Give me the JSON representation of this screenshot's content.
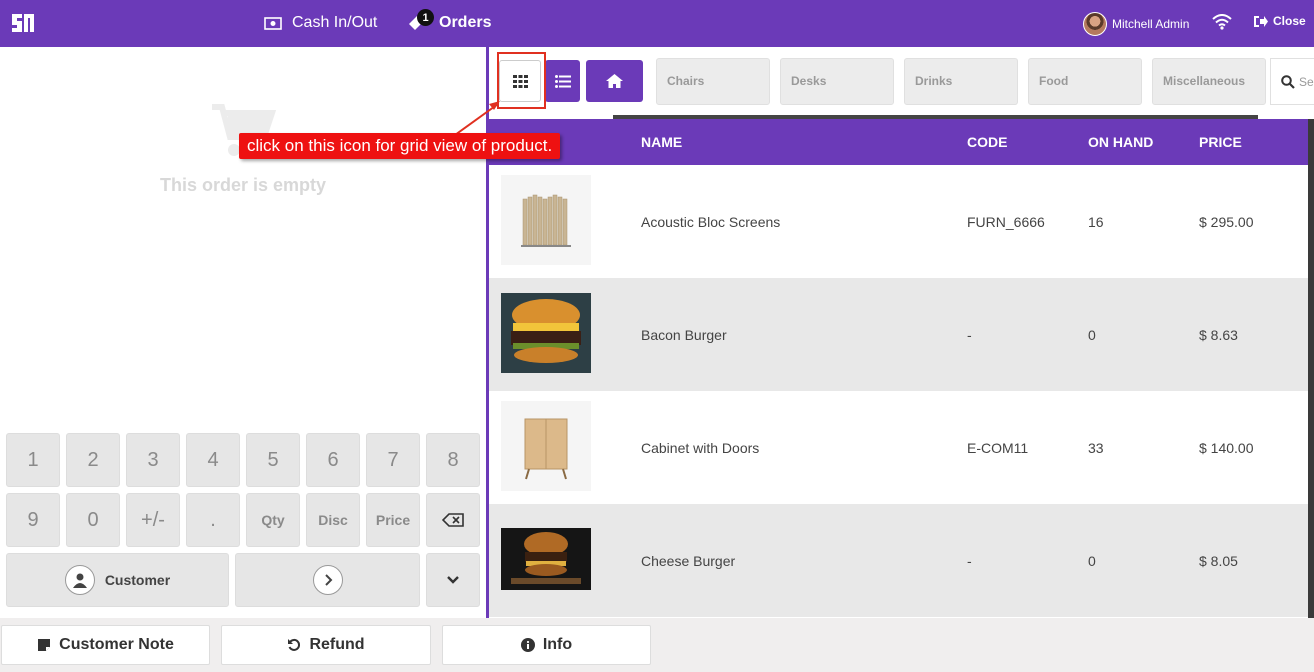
{
  "topbar": {
    "cash_label": "Cash In/Out",
    "orders_label": "Orders",
    "orders_badge": "1",
    "user_name": "Mitchell Admin",
    "close_label": "Close",
    "accent": "#6b3ab8"
  },
  "order": {
    "empty_text": "This order is empty"
  },
  "numpad": {
    "row1": [
      "1",
      "2",
      "3",
      "4",
      "5",
      "6",
      "7",
      "8"
    ],
    "row2": [
      "9",
      "0",
      "+/-",
      ".",
      "Qty",
      "Disc",
      "Price"
    ],
    "customer_label": "Customer"
  },
  "bottom": {
    "customer_note": "Customer Note",
    "refund": "Refund",
    "info": "Info"
  },
  "categories": [
    "Chairs",
    "Desks",
    "Drinks",
    "Food",
    "Miscellaneous"
  ],
  "search": {
    "placeholder": "Se"
  },
  "table": {
    "headers": {
      "name": "NAME",
      "code": "CODE",
      "on_hand": "ON HAND",
      "price": "PRICE"
    },
    "rows": [
      {
        "name": "Acoustic Bloc Screens",
        "code": "FURN_6666",
        "on_hand": "16",
        "price": "$ 295.00",
        "image": "acoustic-screen"
      },
      {
        "name": "Bacon Burger",
        "code": "-",
        "on_hand": "0",
        "price": "$ 8.63",
        "image": "burger"
      },
      {
        "name": "Cabinet with Doors",
        "code": "E-COM11",
        "on_hand": "33",
        "price": "$ 140.00",
        "image": "cabinet"
      },
      {
        "name": "Cheese Burger",
        "code": "-",
        "on_hand": "0",
        "price": "$ 8.05",
        "image": "burger-dark"
      }
    ]
  },
  "annotation": {
    "text": "click on this icon for grid view of product."
  }
}
